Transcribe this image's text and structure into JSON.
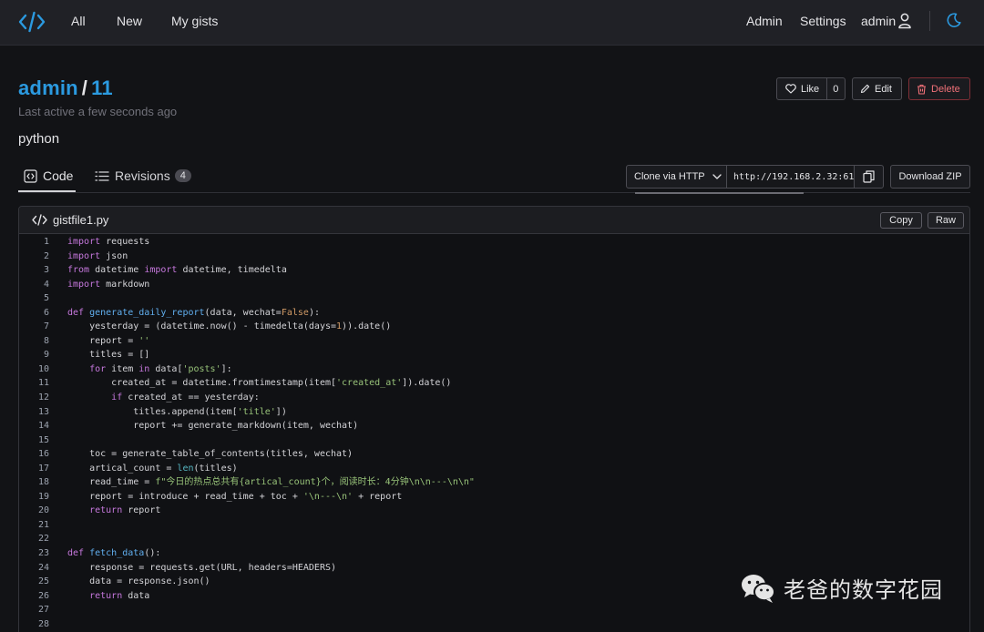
{
  "nav": {
    "links": [
      "All",
      "New",
      "My gists"
    ],
    "admin_label": "Admin",
    "settings_label": "Settings",
    "user_label": "admin",
    "accent_color": "#2b9ae0"
  },
  "gist": {
    "owner": "admin",
    "separator": "/",
    "id": "11",
    "last_active": "Last active a few seconds ago",
    "description": "python",
    "like_label": "Like",
    "like_count": "0",
    "edit_label": "Edit",
    "delete_label": "Delete"
  },
  "tabs": {
    "code_label": "Code",
    "revisions_label": "Revisions",
    "revisions_count": "4"
  },
  "clone": {
    "method": "Clone via HTTP",
    "url": "http://192.168.2.32:61",
    "download_label": "Download ZIP"
  },
  "file": {
    "name": "gistfile1.py",
    "copy_label": "Copy",
    "raw_label": "Raw",
    "lines": [
      "import requests",
      "import json",
      "from datetime import datetime, timedelta",
      "import markdown",
      "",
      "def generate_daily_report(data, wechat=False):",
      "    yesterday = (datetime.now() - timedelta(days=1)).date()",
      "    report = ''",
      "    titles = []",
      "    for item in data['posts']:",
      "        created_at = datetime.fromtimestamp(item['created_at']).date()",
      "        if created_at == yesterday:",
      "            titles.append(item['title'])",
      "            report += generate_markdown(item, wechat)",
      "",
      "    toc = generate_table_of_contents(titles, wechat)",
      "    artical_count = len(titles)",
      "    read_time = f\"今日的热点总共有{artical_count}个，阅读时长：4分钟\\n\\n---\\n\\n\"",
      "    report = introduce + read_time + toc + '\\n---\\n' + report",
      "    return report",
      "",
      "",
      "def fetch_data():",
      "    response = requests.get(URL, headers=HEADERS)",
      "    data = response.json()",
      "    return data",
      "",
      ""
    ]
  },
  "watermark": {
    "text": "老爸的数字花园"
  }
}
